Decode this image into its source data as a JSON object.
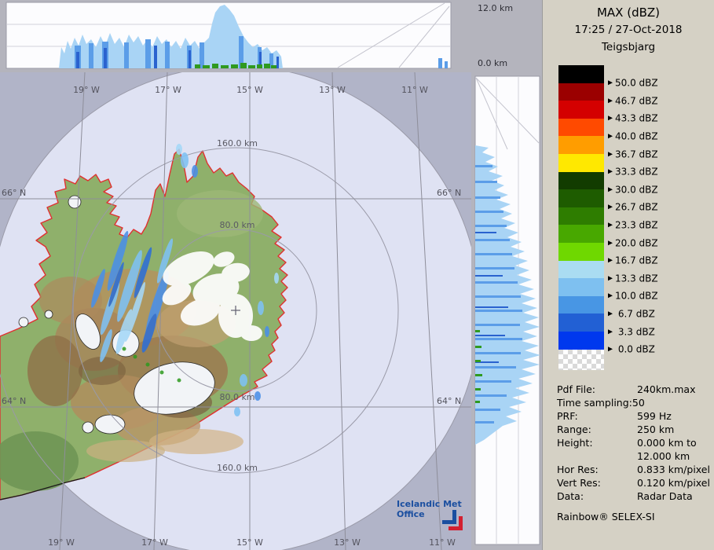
{
  "panel": {
    "title": "MAX (dBZ)",
    "datetime": "17:25 / 27-Oct-2018",
    "station": "Teigsbjarg",
    "legend": {
      "entries": [
        {
          "color": "#000000",
          "label": "50.0 dBZ"
        },
        {
          "color": "#9b0000",
          "label": "46.7 dBZ"
        },
        {
          "color": "#d40000",
          "label": "43.3 dBZ"
        },
        {
          "color": "#ff4a00",
          "label": "40.0 dBZ"
        },
        {
          "color": "#ff9d00",
          "label": "36.7 dBZ"
        },
        {
          "color": "#ffe800",
          "label": "33.3 dBZ"
        },
        {
          "color": "#123c00",
          "label": "30.0 dBZ"
        },
        {
          "color": "#1e5c00",
          "label": "26.7 dBZ"
        },
        {
          "color": "#2e7d00",
          "label": "23.3 dBZ"
        },
        {
          "color": "#48a800",
          "label": "20.0 dBZ"
        },
        {
          "color": "#6fd800",
          "label": "16.7 dBZ"
        },
        {
          "color": "#aadcf2",
          "label": "13.3 dBZ"
        },
        {
          "color": "#7ec0f0",
          "label": "10.0 dBZ"
        },
        {
          "color": "#4896e4",
          "label": " 6.7 dBZ"
        },
        {
          "color": "#2260d4",
          "label": " 3.3 dBZ"
        },
        {
          "color": "#0038ee",
          "label": " 0.0 dBZ"
        }
      ]
    },
    "info": {
      "rows": [
        {
          "label": "Pdf File:",
          "value": "240km.max"
        },
        {
          "label": "Time sampling:50",
          "value": ""
        },
        {
          "label": "PRF:",
          "value": "599 Hz"
        },
        {
          "label": "Range:",
          "value": "250 km"
        },
        {
          "label": "Height:",
          "value": "0.000 km to"
        },
        {
          "label": "",
          "value": "12.000 km"
        },
        {
          "label": "Hor Res:",
          "value": "0.833 km/pixel"
        },
        {
          "label": "Vert Res:",
          "value": "0.120 km/pixel"
        },
        {
          "label": "Data:",
          "value": "Radar Data"
        }
      ],
      "footer": "Rainbow® SELEX-SI"
    }
  },
  "height_axis": {
    "top": "12.0 km",
    "bottom": "0.0 km"
  },
  "map": {
    "lon_top": [
      "19° W",
      "17° W",
      "15° W",
      "13° W",
      "11° W"
    ],
    "lon_bottom": [
      "19° W",
      "17° W",
      "15° W",
      "13° W",
      "11° W"
    ],
    "lat_left": [
      "66° N",
      "64° N"
    ],
    "lat_right": [
      "66° N",
      "64° N"
    ],
    "rings": [
      "160.0 km",
      "80.0 km",
      "80.0 km",
      "160.0 km"
    ],
    "logo_line1": "Icelandic Met",
    "logo_line2": "Office"
  }
}
